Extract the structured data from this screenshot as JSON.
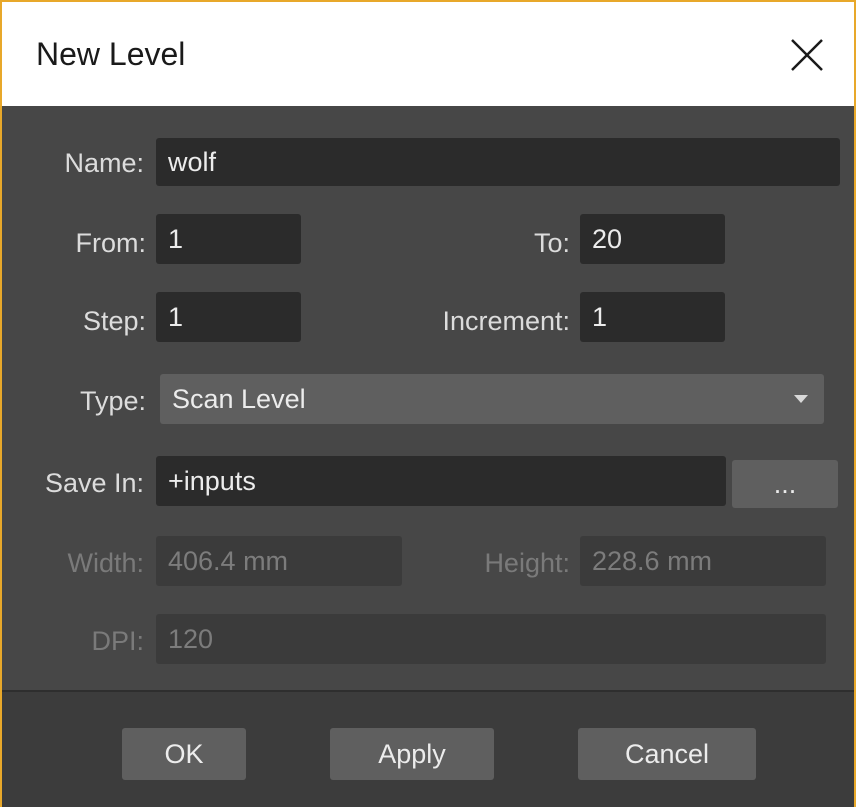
{
  "dialog": {
    "title": "New Level",
    "close_icon": "close-icon"
  },
  "form": {
    "name_label": "Name:",
    "name_value": "wolf",
    "from_label": "From:",
    "from_value": "1",
    "to_label": "To:",
    "to_value": "20",
    "step_label": "Step:",
    "step_value": "1",
    "increment_label": "Increment:",
    "increment_value": "1",
    "type_label": "Type:",
    "type_value": "Scan Level",
    "save_in_label": "Save In:",
    "save_in_value": "+inputs",
    "browse_label": "...",
    "width_label": "Width:",
    "width_value": "406.4 mm",
    "height_label": "Height:",
    "height_value": "228.6 mm",
    "dpi_label": "DPI:",
    "dpi_value": "120"
  },
  "buttons": {
    "ok": "OK",
    "apply": "Apply",
    "cancel": "Cancel"
  },
  "colors": {
    "window_border": "#e8a82a",
    "background": "#474747",
    "field": "#2b2b2b",
    "button": "#5f5f5f"
  }
}
